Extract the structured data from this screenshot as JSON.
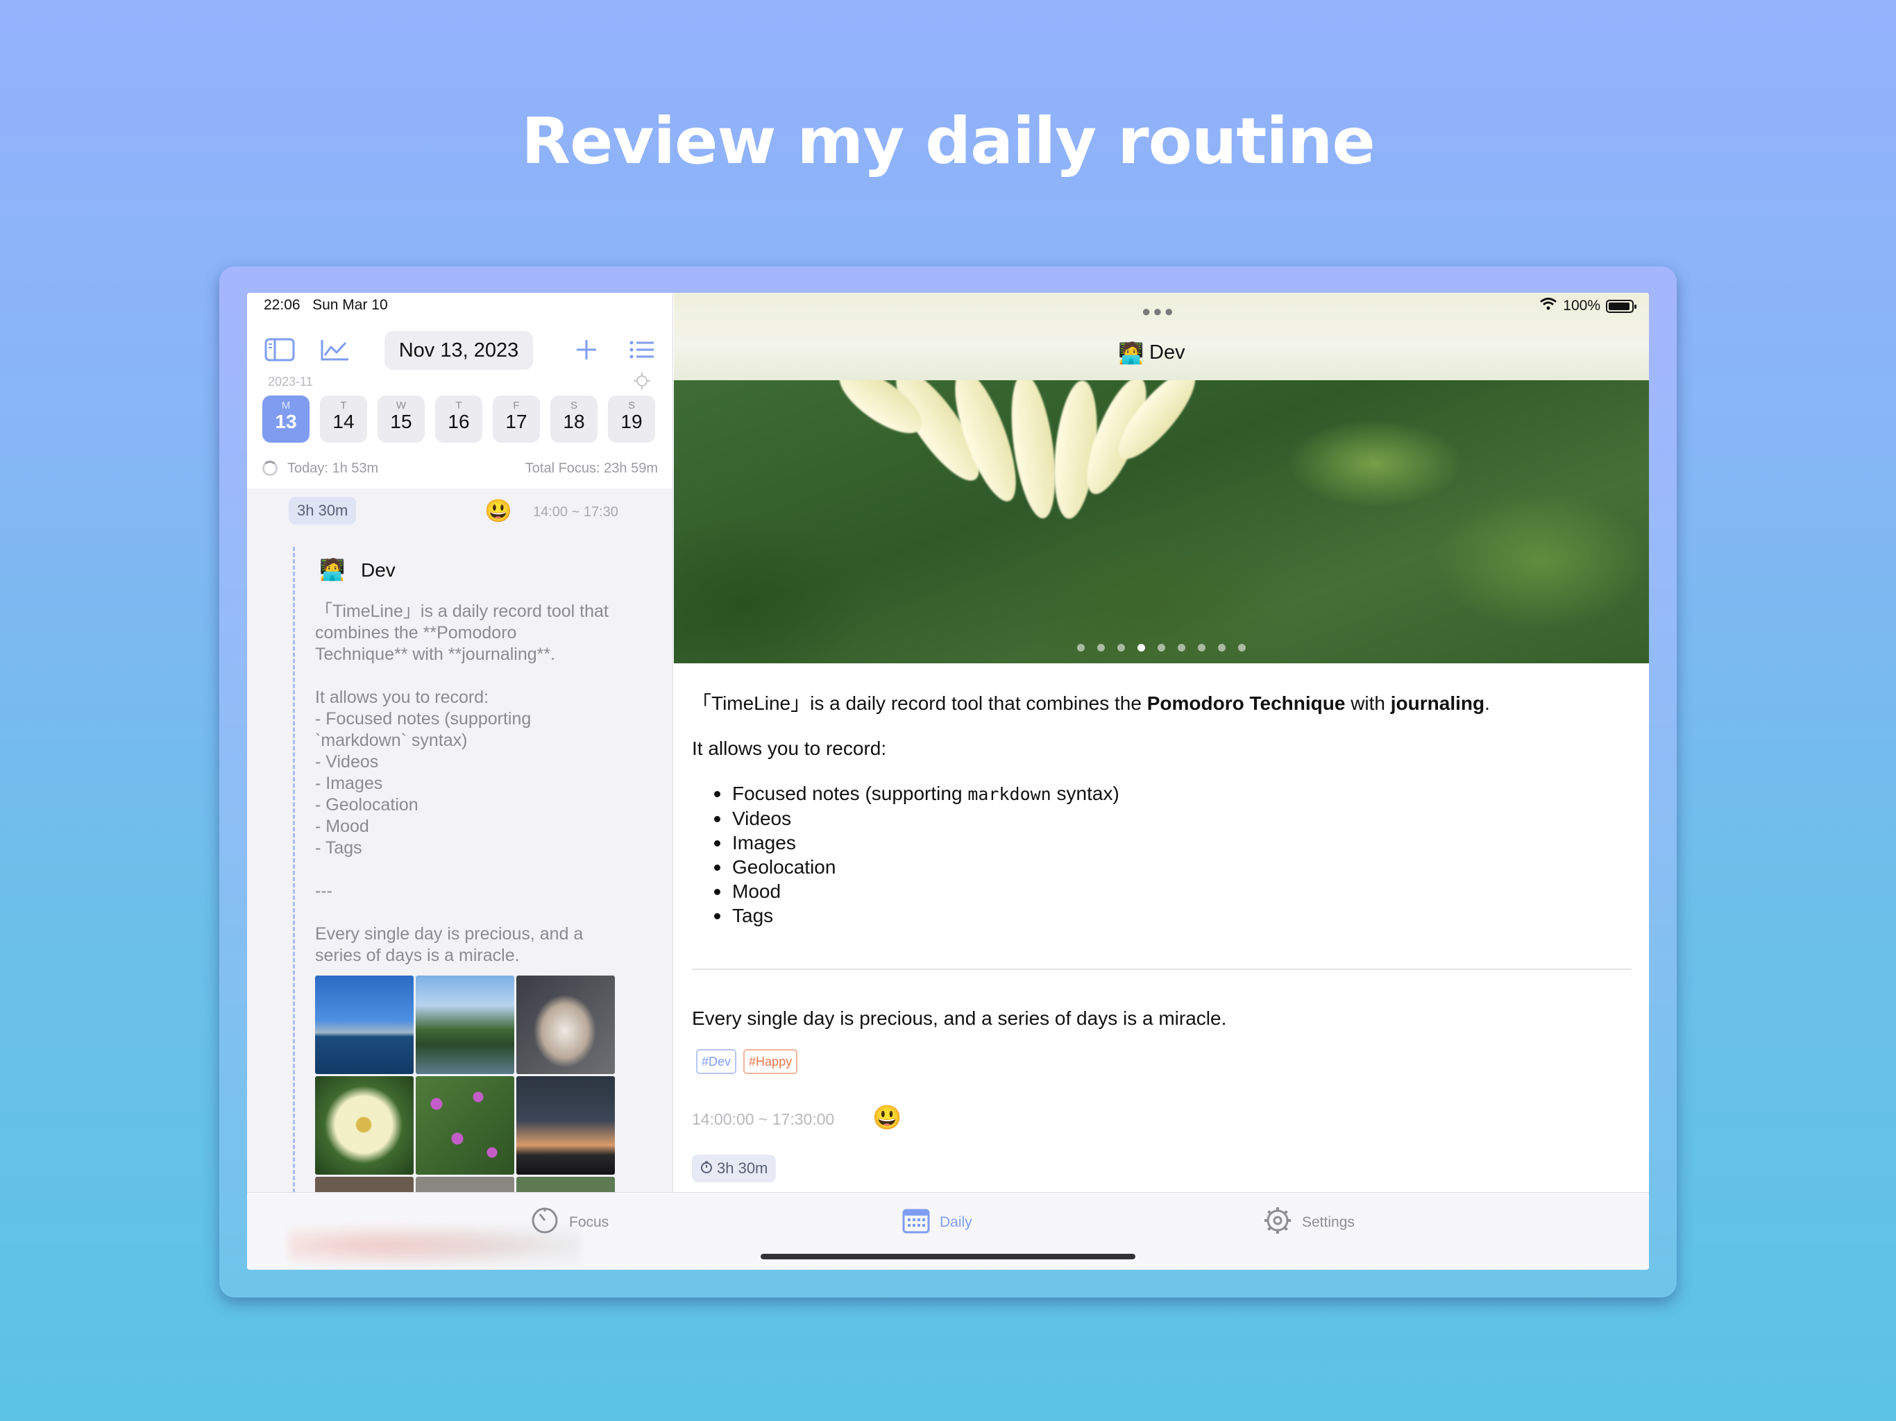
{
  "headline": "Review my daily routine",
  "status": {
    "time": "22:06",
    "date": "Sun Mar 10",
    "battery": "100%"
  },
  "toolbar": {
    "date": "Nov 13, 2023",
    "month": "2023-11"
  },
  "week": [
    {
      "dow": "M",
      "num": "13",
      "active": true
    },
    {
      "dow": "T",
      "num": "14"
    },
    {
      "dow": "W",
      "num": "15"
    },
    {
      "dow": "T",
      "num": "16"
    },
    {
      "dow": "F",
      "num": "17"
    },
    {
      "dow": "S",
      "num": "18"
    },
    {
      "dow": "S",
      "num": "19"
    }
  ],
  "stats": {
    "today": "Today:  1h 53m",
    "total": "Total Focus:  23h 59m"
  },
  "entry": {
    "duration": "3h 30m",
    "mood": "😃",
    "range": "14:00 ~ 17:30",
    "title_emoji": "🧑‍💻",
    "title": "Dev",
    "raw_lines": [
      "「TimeLine」is a daily record tool that",
      "combines the **Pomodoro",
      "Technique** with **journaling**.",
      "",
      "It allows you to record:",
      "- Focused notes (supporting",
      "`markdown` syntax)",
      "- Videos",
      "- Images",
      "- Geolocation",
      "- Mood",
      "- Tags",
      "",
      "---",
      "",
      "Every single day is precious, and a",
      "series of days is a miracle."
    ]
  },
  "detail": {
    "title_emoji": "🧑‍💻",
    "title": "Dev",
    "intro_pre": "「TimeLine」is a daily record tool that combines the ",
    "intro_b1": "Pomodoro Technique",
    "intro_mid": " with ",
    "intro_b2": "journaling",
    "intro_end": ".",
    "allows": "It allows you to record:",
    "bullet1_pre": "Focused notes (supporting ",
    "bullet1_code": "markdown",
    "bullet1_post": " syntax)",
    "bullets": [
      "Videos",
      "Images",
      "Geolocation",
      "Mood",
      "Tags"
    ],
    "quote": "Every single day is precious, and a series of days is a miracle.",
    "tags": [
      "#Dev",
      "#Happy"
    ],
    "range": "14:00:00 ~ 17:30:00",
    "mood": "😃",
    "duration": "3h 30m",
    "carousel_total": 9,
    "carousel_active": 4
  },
  "tabs": [
    {
      "label": "Focus",
      "icon": "timer-icon"
    },
    {
      "label": "Daily",
      "icon": "calendar-icon",
      "active": true
    },
    {
      "label": "Settings",
      "icon": "gear-icon"
    }
  ],
  "colors": {
    "accent": "#7f9cf0",
    "tag_dev": "#7f9cf0",
    "tag_happy": "#e7764b"
  }
}
